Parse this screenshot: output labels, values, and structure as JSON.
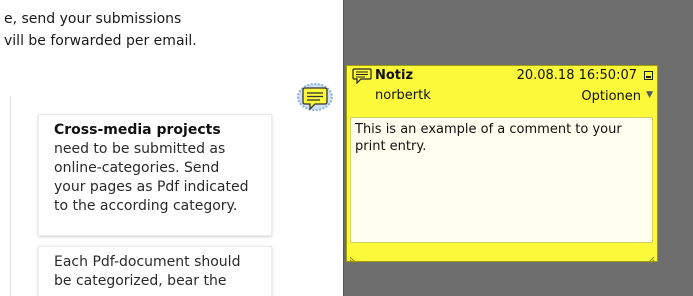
{
  "document": {
    "intro_lines": [
      "e, send your submissions",
      "vill be forwarded per email."
    ],
    "box1": {
      "heading": "Cross-media projects",
      "lines": [
        "need to be submitted as",
        "online-categories. Send",
        "your pages as Pdf indicated",
        "to the according category."
      ]
    },
    "box2": {
      "lines": [
        "Each Pdf-document should",
        "be categorized, bear the"
      ]
    }
  },
  "comment_marker": {
    "icon": "speech-bubble-icon"
  },
  "note": {
    "title": "Notiz",
    "datetime": "20.08.18 16:50:07",
    "author": "norbertk",
    "options_label": "Optionen",
    "text": "This is an example of a comment to your print entry.",
    "color": "#fcf93b"
  },
  "colors": {
    "workspace": "#6e6e6e",
    "note_yellow": "#fcf93b",
    "marker_blue": "#8fb4dc"
  }
}
